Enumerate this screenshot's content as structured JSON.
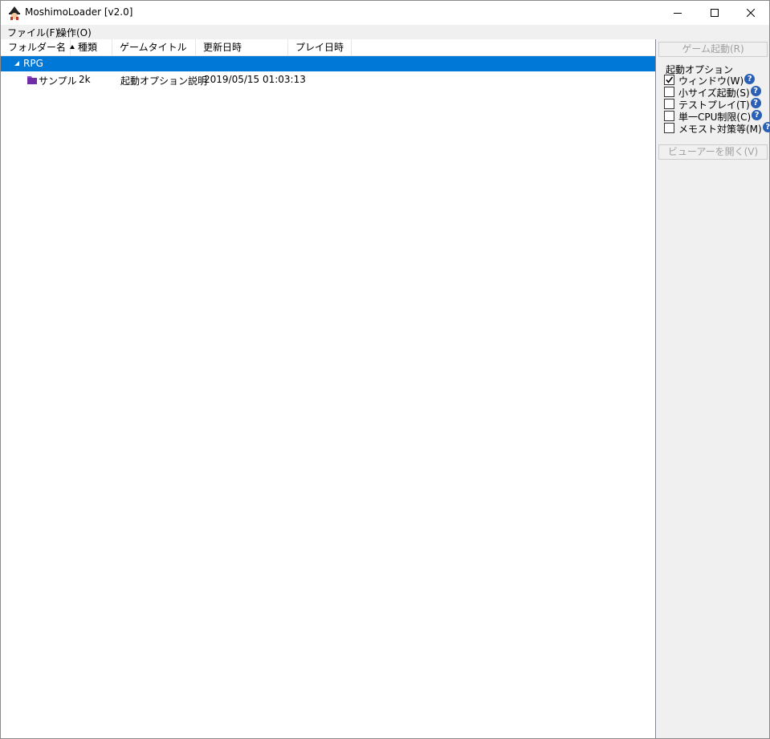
{
  "window": {
    "title": "MoshimoLoader [v2.0]"
  },
  "titlebar": {
    "minimize_icon": "minimize-icon",
    "maximize_icon": "maximize-icon",
    "close_icon": "close-icon"
  },
  "menu": {
    "items": [
      {
        "label": "ファイル(F)"
      },
      {
        "label": "操作(O)"
      }
    ]
  },
  "list": {
    "columns": [
      {
        "label": "フォルダー名"
      },
      {
        "label": "種類"
      },
      {
        "label": "ゲームタイトル"
      },
      {
        "label": "更新日時"
      },
      {
        "label": "プレイ日時"
      }
    ],
    "group": {
      "label": "RPG",
      "expanded": true
    },
    "rows": [
      {
        "folder": "サンプル",
        "type": "2k",
        "title": "起動オプション説明",
        "updated": "2019/05/15 01:03:13",
        "played": ""
      }
    ]
  },
  "side": {
    "launch_button": "ゲーム起動(R)",
    "options_title": "起動オプション",
    "options": [
      {
        "label": "ウィンドウ(W)",
        "checked": true
      },
      {
        "label": "小サイズ起動(S)",
        "checked": false
      },
      {
        "label": "テストプレイ(T)",
        "checked": false
      },
      {
        "label": "単一CPU制限(C)",
        "checked": false
      },
      {
        "label": "メモスト対策等(M)",
        "checked": false
      }
    ],
    "help_glyph": "?",
    "viewer_button": "ビューアーを開く(V)"
  },
  "colors": {
    "selection": "#0078d7",
    "help_icon": "#2a5fb6",
    "folder_icon": "#6f2da8"
  }
}
